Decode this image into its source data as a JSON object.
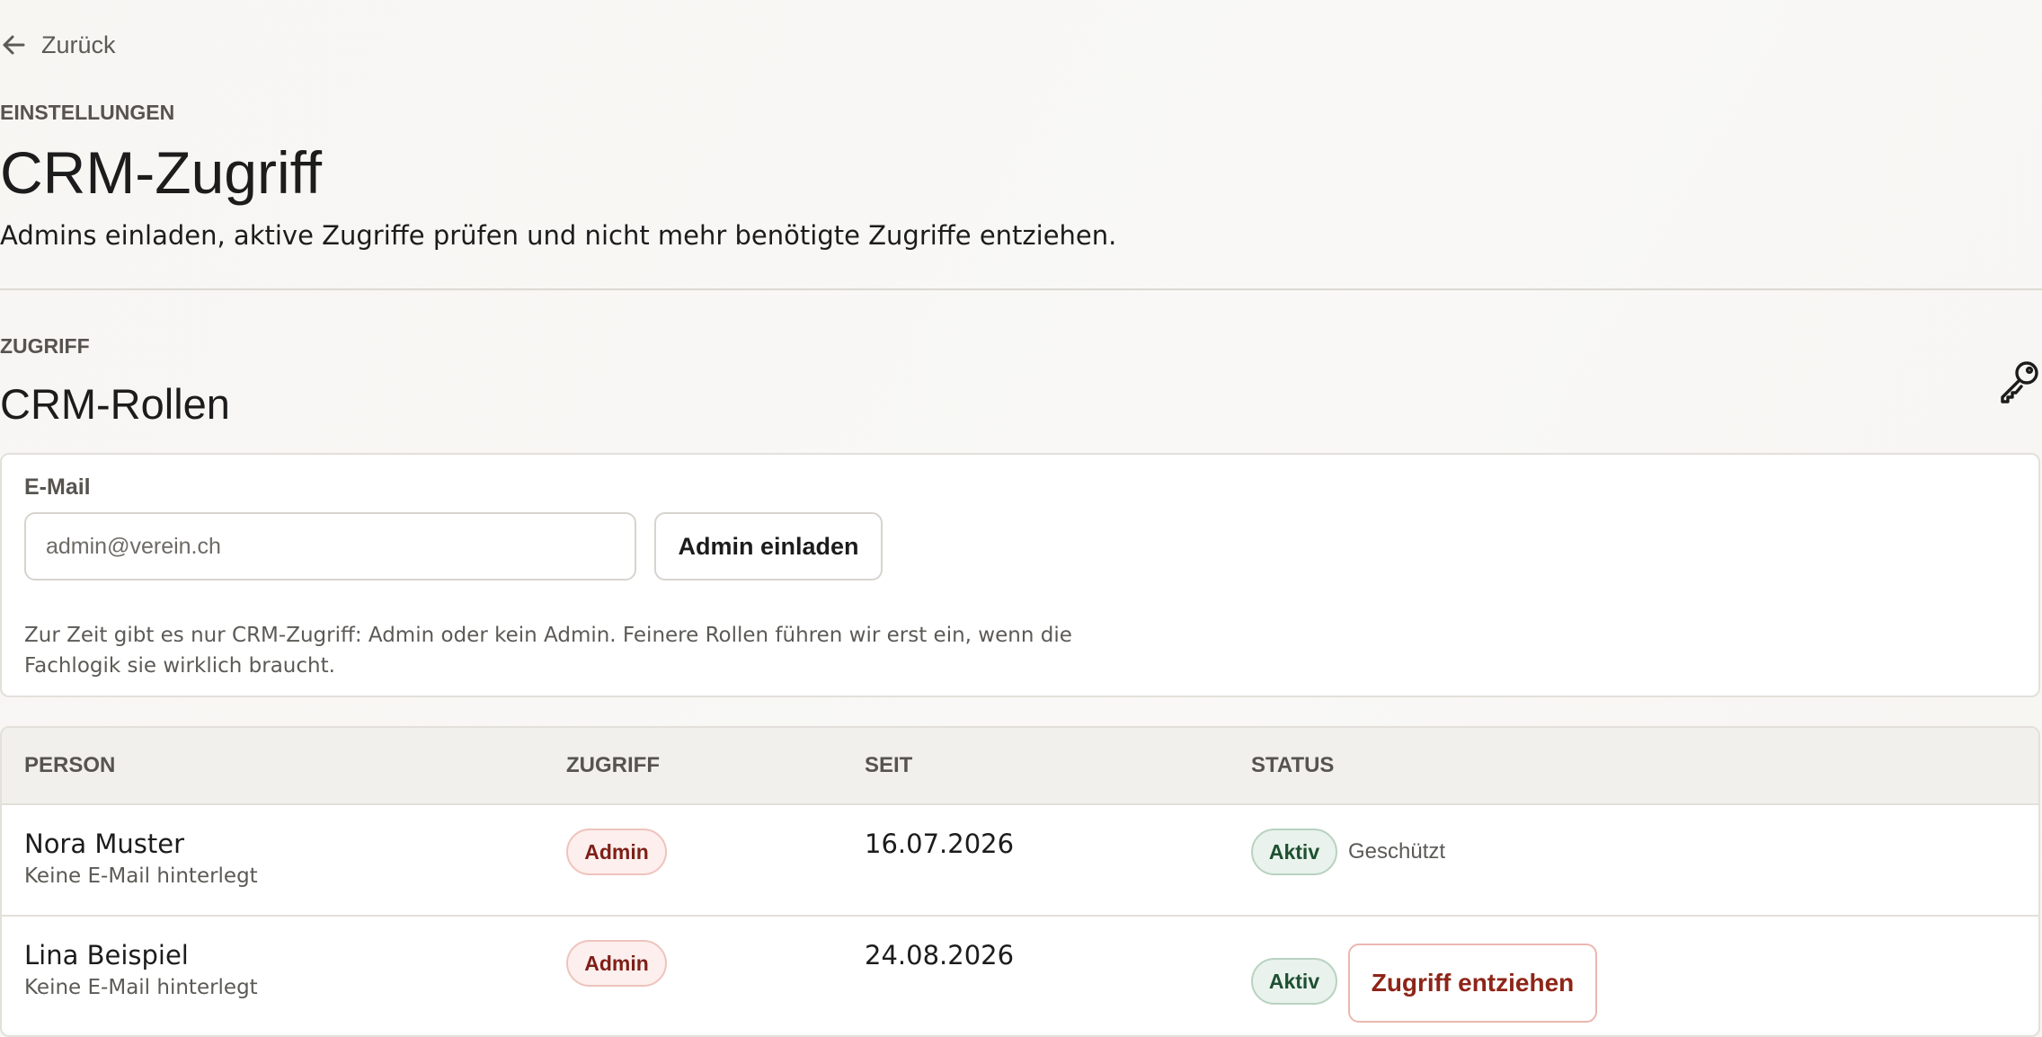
{
  "nav": {
    "back_label": "Zurück"
  },
  "header": {
    "eyebrow": "EINSTELLUNGEN",
    "title": "CRM-Zugriff",
    "description": "Admins einladen, aktive Zugriffe prüfen und nicht mehr benötigte Zugriffe entziehen."
  },
  "section": {
    "eyebrow": "ZUGRIFF",
    "title": "CRM-Rollen",
    "icon": "key-icon"
  },
  "invite": {
    "email_label": "E-Mail",
    "email_value": "",
    "email_placeholder": "admin@verein.ch",
    "button_label": "Admin einladen",
    "note": "Zur Zeit gibt es nur CRM-Zugriff: Admin oder kein Admin. Feinere Rollen führen wir erst ein, wenn die Fachlogik sie wirklich braucht."
  },
  "table": {
    "columns": [
      "PERSON",
      "ZUGRIFF",
      "SEIT",
      "STATUS"
    ],
    "rows": [
      {
        "name": "Nora Muster",
        "email": "Keine E-Mail hinterlegt",
        "access": "Admin",
        "since": "16.07.2026",
        "status": "Aktiv",
        "note": "Geschützt"
      },
      {
        "name": "Lina Beispiel",
        "email": "Keine E-Mail hinterlegt",
        "access": "Admin",
        "since": "24.08.2026",
        "status": "Aktiv",
        "action_label": "Zugriff entziehen"
      }
    ]
  },
  "colors": {
    "accent_red": "#8e2518",
    "admin_pill_bg": "#fcefed",
    "aktiv_pill_bg": "#e9f2ec",
    "aktiv_text": "#1d5030",
    "background": "#f7f6f3"
  }
}
